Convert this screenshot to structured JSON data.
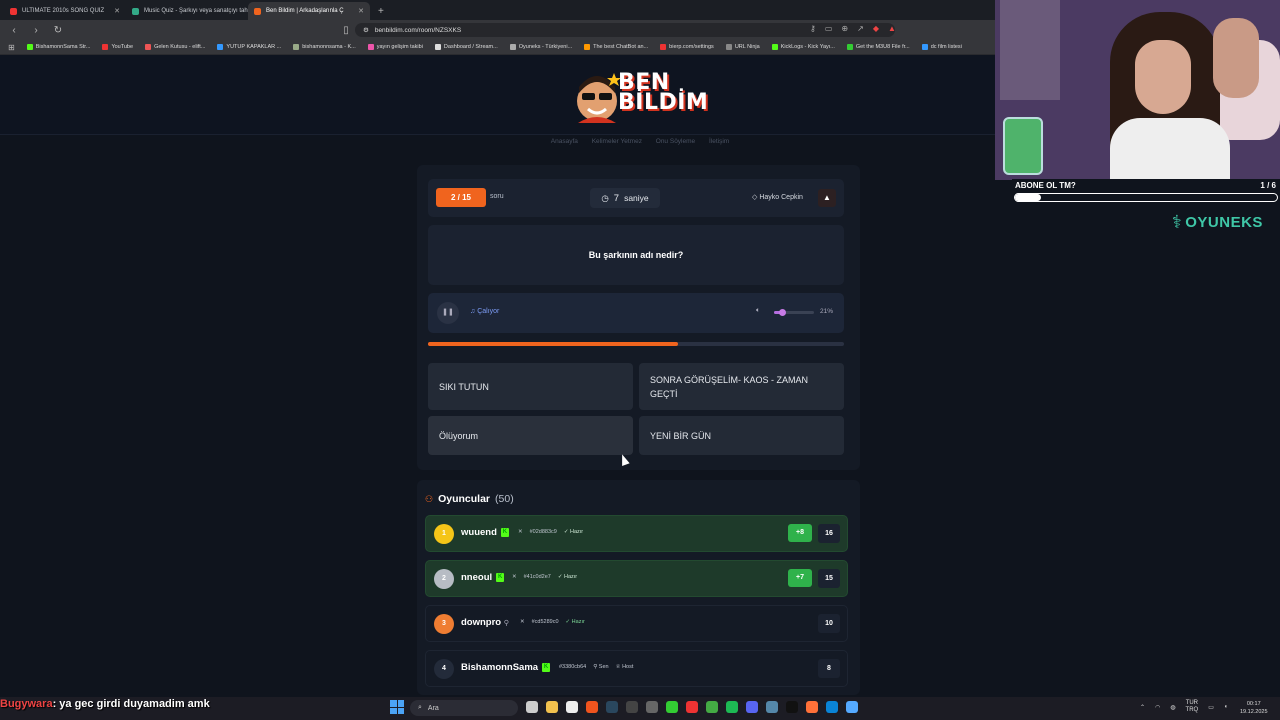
{
  "browser": {
    "tabs": [
      {
        "title": "ULTIMATE 2010s SONG QUIZ",
        "color": "#e33",
        "active": false
      },
      {
        "title": "Music Quiz - Şarkıyı veya sanatçıyı tah",
        "color": "#3a8",
        "active": false
      },
      {
        "title": "Ben Bildim | Arkadaşlarınla Ç",
        "color": "#f0641e",
        "active": true
      }
    ],
    "url": "benbildim.com/room/NZSXKS",
    "bookmarks": [
      {
        "label": "BishamonnSama Str...",
        "color": "#53fc18"
      },
      {
        "label": "YouTube",
        "color": "#e33"
      },
      {
        "label": "Gelen Kutusu - elift...",
        "color": "#e55"
      },
      {
        "label": "YUTUP KAPAKLAR ...",
        "color": "#39f"
      },
      {
        "label": "bishamonnsama - K...",
        "color": "#9a8"
      },
      {
        "label": "yayın gelişim takibi",
        "color": "#e5a"
      },
      {
        "label": "Dashboard / Stream...",
        "color": "#ddd"
      },
      {
        "label": "Oyuneks - Türkiyeni...",
        "color": "#aaa"
      },
      {
        "label": "The best ChatBot an...",
        "color": "#f90"
      },
      {
        "label": "bierp.com/settings",
        "color": "#e33"
      },
      {
        "label": "URL Ninja",
        "color": "#888"
      },
      {
        "label": "KickLogs - Kick Yayı...",
        "color": "#53fc18"
      },
      {
        "label": "Get the M3U8 File fr...",
        "color": "#3c3"
      },
      {
        "label": "dc film listesi",
        "color": "#39f"
      }
    ]
  },
  "site": {
    "logo": {
      "line1": "BEN",
      "line2": "BİLDİM"
    },
    "nav": [
      "Anasayfa",
      "Kelimeler Yetmez",
      "Onu Söyleme",
      "İletişim"
    ]
  },
  "game": {
    "question_badge": "2 / 15",
    "question_label": "soru",
    "timer_value": "7",
    "timer_label": "saniye",
    "singer_label": "Hayko Cepkin",
    "question": "Bu şarkının adı nedir?",
    "player_status": "Çalıyor",
    "volume_percent": 21,
    "volume_label": "21%",
    "progress_fraction": 0.6,
    "answers": [
      "SIKI TUTUN",
      "SONRA GÖRÜŞELİM- KAOS - ZAMAN GEÇTİ",
      "Ölüyorum",
      "YENİ BİR GÜN"
    ]
  },
  "players": {
    "title": "Oyuncular",
    "count": "(50)",
    "rows": [
      {
        "rank": "1",
        "name": "wuuend",
        "code": "#02d883c9",
        "status": "Hazır",
        "gain": "+8",
        "score": "16",
        "rank_color": "#f5c518",
        "highlight": true,
        "kick": true
      },
      {
        "rank": "2",
        "name": "nneoul",
        "code": "#41c0d2e7",
        "status": "Hazır",
        "gain": "+7",
        "score": "15",
        "rank_color": "#b7bcc4",
        "highlight": true,
        "kick": true
      },
      {
        "rank": "3",
        "name": "downpro",
        "code": "#cd5289c0",
        "status": "Hazır",
        "gain": "",
        "score": "10",
        "rank_color": "#ef7d32",
        "highlight": false,
        "kick": false
      },
      {
        "rank": "4",
        "name": "BishamonnSama",
        "code": "#3380cb64",
        "status": "Sen",
        "host": "Host",
        "gain": "",
        "score": "8",
        "rank_color": "#232b3a",
        "highlight": false,
        "kick": true
      }
    ]
  },
  "stream": {
    "sub_goal_title": "ABONE OL TM?",
    "sub_goal_count": "1 / 6",
    "sub_goal_fraction": 0.1,
    "sponsor": "OYUNEKS",
    "chat_user": "Bugywara",
    "chat_message": ": ya gec girdi duyamadim amk"
  },
  "taskbar": {
    "search_placeholder": "Ara",
    "lang_line1": "TUR",
    "lang_line2": "TRQ",
    "time": "00:17",
    "date": "19.12.2025"
  }
}
